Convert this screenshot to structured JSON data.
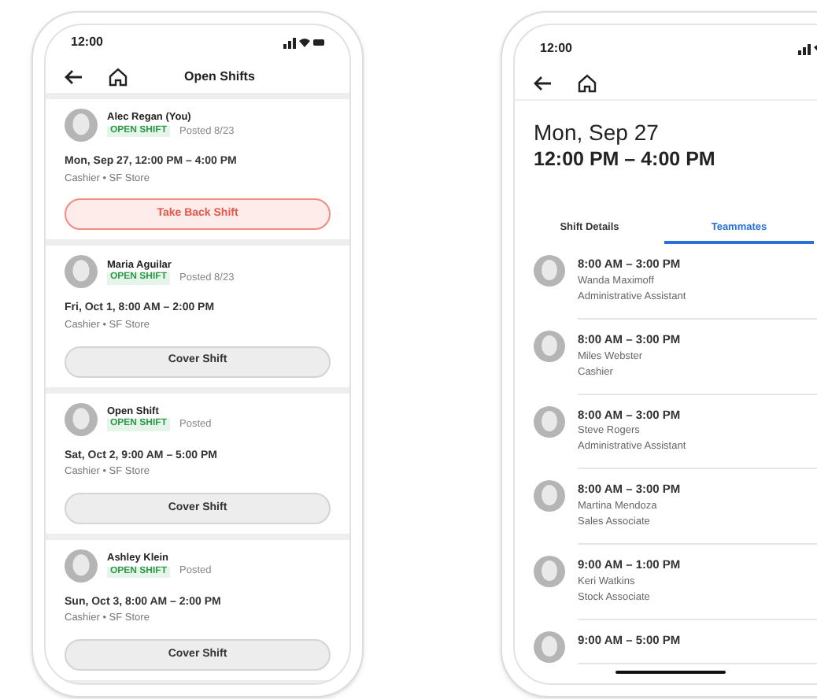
{
  "left_phone": {
    "status_time": "12:00",
    "title": "Open Shifts",
    "shifts": [
      {
        "name": "Alec Regan (You)",
        "badge": "OPEN SHIFT",
        "posted": "Posted 8/23",
        "when": "Mon, Sep 27, 12:00 PM – 4:00 PM",
        "where": "Cashier • SF Store",
        "action": {
          "label": "Take Back Shift",
          "kind": "danger"
        }
      },
      {
        "name": "Maria Aguilar",
        "badge": "OPEN SHIFT",
        "posted": "Posted 8/23",
        "when": "Fri, Oct 1, 8:00 AM – 2:00 PM",
        "where": "Cashier • SF Store",
        "action": {
          "label": "Cover Shift",
          "kind": "default"
        }
      },
      {
        "name": "Open Shift",
        "badge": "OPEN SHIFT",
        "posted": "Posted",
        "when": "Sat, Oct 2, 9:00 AM – 5:00 PM",
        "where": "Cashier • SF Store",
        "action": {
          "label": "Cover Shift",
          "kind": "default"
        }
      },
      {
        "name": "Ashley Klein",
        "badge": "OPEN SHIFT",
        "posted": "Posted",
        "when": "Sun, Oct 3, 8:00 AM – 2:00 PM",
        "where": "Cashier • SF Store",
        "action": {
          "label": "Cover Shift",
          "kind": "default"
        }
      }
    ]
  },
  "right_phone": {
    "status_time": "12:00",
    "date": "Mon, Sep 27",
    "time": "12:00 PM – 4:00 PM",
    "tabs": [
      {
        "label": "Shift Details",
        "selected": false
      },
      {
        "label": "Teammates",
        "selected": true
      }
    ],
    "teammates": [
      {
        "time": "8:00 AM – 3:00 PM",
        "name": "Wanda Maximoff",
        "role": "Administrative Assistant"
      },
      {
        "time": "8:00 AM – 3:00 PM",
        "name": "Miles Webster",
        "role": "Cashier"
      },
      {
        "time": "8:00 AM – 3:00 PM",
        "name": "Steve Rogers",
        "role": "Administrative Assistant"
      },
      {
        "time": "8:00 AM – 3:00 PM",
        "name": "Martina Mendoza",
        "role": "Sales Associate"
      },
      {
        "time": "9:00 AM – 1:00 PM",
        "name": "Keri Watkins",
        "role": "Stock Associate"
      },
      {
        "time": "9:00 AM – 5:00 PM"
      }
    ]
  }
}
